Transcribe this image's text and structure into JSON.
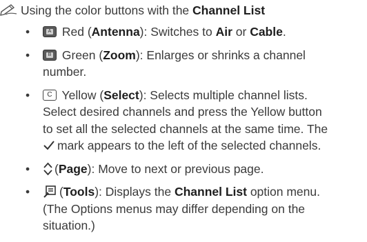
{
  "heading": {
    "icon": "note-pencil-icon",
    "prefix": "Using the color buttons with the ",
    "bold": "Channel List"
  },
  "items": [
    {
      "icon": "red-button-icon",
      "icon_letter": "A",
      "l1_a": "Red (",
      "l1_b": "Antenna",
      "l1_c": "): Switches to ",
      "l1_d": "Air",
      "l1_e": " or ",
      "l1_f": "Cable",
      "l1_g": "."
    },
    {
      "icon": "green-button-icon",
      "icon_letter": "B",
      "l1_a": "Green (",
      "l1_b": "Zoom",
      "l1_c": "): Enlarges or shrinks a channel",
      "l2": "number."
    },
    {
      "icon": "yellow-button-icon",
      "icon_letter": "C",
      "l1_a": "Yellow (",
      "l1_b": "Select",
      "l1_c": "): Selects multiple channel lists.",
      "l2": "Select desired channels and press the Yellow button",
      "l3": "to set all the selected channels at the same time. The",
      "l4": "mark appears to the left of the selected channels."
    },
    {
      "icon": "page-updown-icon",
      "l1_a": "(",
      "l1_b": "Page",
      "l1_c": "): Move to next or previous page."
    },
    {
      "icon": "tools-icon",
      "l1_a": "(",
      "l1_b": "Tools",
      "l1_c": "): Displays the ",
      "l1_d": "Channel List",
      "l1_e": " option menu.",
      "l2": "(The Options menus may differ depending on the",
      "l3": "situation.)"
    }
  ],
  "bullet": "•"
}
